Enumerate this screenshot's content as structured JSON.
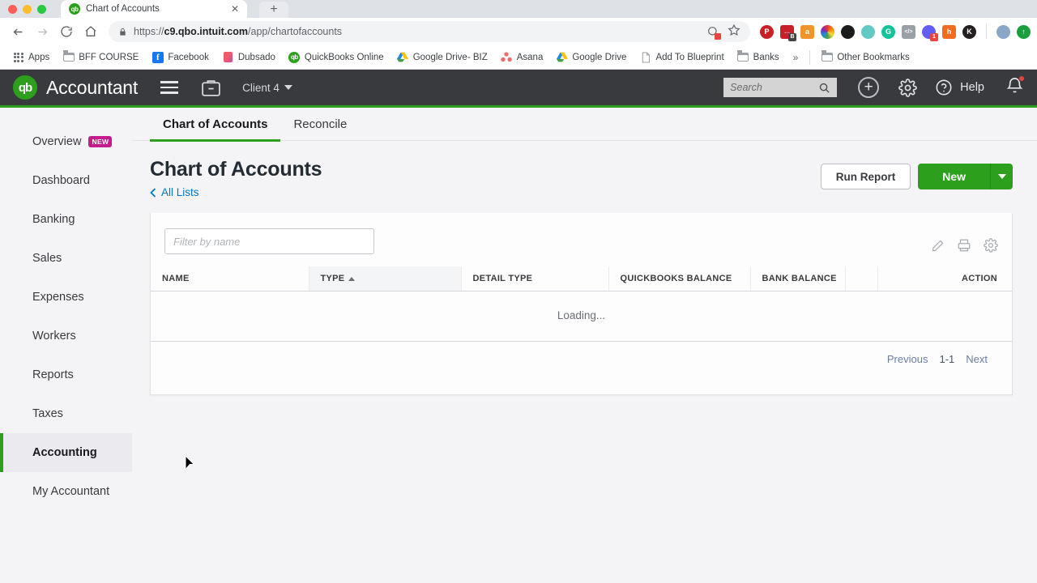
{
  "browser": {
    "tab": {
      "title": "Chart of Accounts",
      "favicon": "qb",
      "close_icon": "close-icon"
    },
    "new_tab_label": "+",
    "url_secure_part": "https://c9.qbo.intuit.com",
    "url_host_bold": "c9.qbo.intuit.com",
    "url_prefix": "https://",
    "url_path": "/app/chartofaccounts",
    "nav": {
      "back": "back-icon",
      "forward": "forward-icon",
      "reload": "reload-icon",
      "home": "home-icon"
    },
    "extensions": [
      {
        "name": "pinterest",
        "glyph": "P",
        "color": "#cb1f27",
        "shape": "circle"
      },
      {
        "name": "bitly",
        "glyph": "",
        "color": "#c8202a",
        "shape": "square",
        "badge": "B",
        "badge_color": "dark"
      },
      {
        "name": "amazon-assistant",
        "glyph": "a",
        "color": "#f0952a",
        "shape": "square"
      },
      {
        "name": "colorzilla",
        "glyph": "",
        "color": "#7a5cc6",
        "shape": "circle"
      },
      {
        "name": "dark-reader",
        "glyph": "",
        "color": "#1b1b1b",
        "shape": "circle"
      },
      {
        "name": "octopus",
        "glyph": "",
        "color": "#62c9c3",
        "shape": "circle"
      },
      {
        "name": "grammarly",
        "glyph": "G",
        "color": "#15c39a",
        "shape": "circle"
      },
      {
        "name": "code-inspector",
        "glyph": "</>",
        "color": "#9aa0a6",
        "shape": "square"
      },
      {
        "name": "loom",
        "glyph": "",
        "color": "#625df5",
        "shape": "circle",
        "badge": "1",
        "badge_color": "red"
      },
      {
        "name": "honey",
        "glyph": "h",
        "color": "#f26b21",
        "shape": "square"
      },
      {
        "name": "klaviyo",
        "glyph": "K",
        "color": "#231f20",
        "shape": "circle"
      }
    ],
    "profile_avatar": "avatar",
    "update_button": "update-icon",
    "bookmarks": [
      {
        "label": "Apps",
        "icon": "apps-grid-icon"
      },
      {
        "label": "BFF COURSE",
        "icon": "folder-icon"
      },
      {
        "label": "Facebook",
        "icon": "facebook-icon"
      },
      {
        "label": "Dubsado",
        "icon": "dubsado-icon"
      },
      {
        "label": "QuickBooks Online",
        "icon": "quickbooks-icon"
      },
      {
        "label": "Google Drive- BIZ",
        "icon": "google-drive-icon"
      },
      {
        "label": "Asana",
        "icon": "asana-icon"
      },
      {
        "label": "Google Drive",
        "icon": "google-drive-icon"
      },
      {
        "label": "Add To Blueprint",
        "icon": "page-icon"
      },
      {
        "label": "Banks",
        "icon": "folder-icon"
      }
    ],
    "overflow_label": "»",
    "other_bookmarks": {
      "label": "Other Bookmarks",
      "icon": "folder-icon"
    }
  },
  "app_header": {
    "logo_text": "qb",
    "brand": "Accountant",
    "menu_icon": "hamburger-icon",
    "briefcase_icon": "briefcase-icon",
    "client_selector": "Client 4",
    "search_placeholder": "Search",
    "add_icon": "plus-icon",
    "settings_icon": "gear-icon",
    "help_icon": "help-icon",
    "help_label": "Help",
    "notifications_icon": "bell-icon",
    "accent_color": "#2ca01c",
    "bar_color": "#393a3d"
  },
  "sidebar": {
    "items": [
      {
        "label": "Overview",
        "badge": "NEW",
        "active": false
      },
      {
        "label": "Dashboard",
        "badge": "",
        "active": false
      },
      {
        "label": "Banking",
        "badge": "",
        "active": false
      },
      {
        "label": "Sales",
        "badge": "",
        "active": false
      },
      {
        "label": "Expenses",
        "badge": "",
        "active": false
      },
      {
        "label": "Workers",
        "badge": "",
        "active": false
      },
      {
        "label": "Reports",
        "badge": "",
        "active": false
      },
      {
        "label": "Taxes",
        "badge": "",
        "active": false
      },
      {
        "label": "Accounting",
        "badge": "",
        "active": true
      },
      {
        "label": "My Accountant",
        "badge": "",
        "active": false
      }
    ]
  },
  "main": {
    "tabs": [
      {
        "label": "Chart of Accounts",
        "active": true
      },
      {
        "label": "Reconcile",
        "active": false
      }
    ],
    "page_title": "Chart of Accounts",
    "breadcrumb_label": "All Lists",
    "breadcrumb_icon": "chevron-left-icon",
    "run_report_label": "Run Report",
    "new_label": "New",
    "new_caret_icon": "chevron-down-icon",
    "filter_placeholder": "Filter by name",
    "tools": [
      {
        "name": "pencil-icon"
      },
      {
        "name": "print-icon"
      },
      {
        "name": "gear-icon"
      }
    ],
    "table": {
      "columns": [
        {
          "label": "NAME",
          "sorted": false
        },
        {
          "label": "TYPE",
          "sorted": true,
          "sort_dir": "asc"
        },
        {
          "label": "DETAIL TYPE",
          "sorted": false
        },
        {
          "label": "QUICKBOOKS BALANCE",
          "sorted": false
        },
        {
          "label": "BANK BALANCE",
          "sorted": false
        },
        {
          "label": "",
          "sorted": false
        },
        {
          "label": "ACTION",
          "sorted": false
        }
      ],
      "loading_text": "Loading...",
      "rows": []
    },
    "pagination": {
      "previous_label": "Previous",
      "range_label": "1-1",
      "next_label": "Next"
    }
  }
}
